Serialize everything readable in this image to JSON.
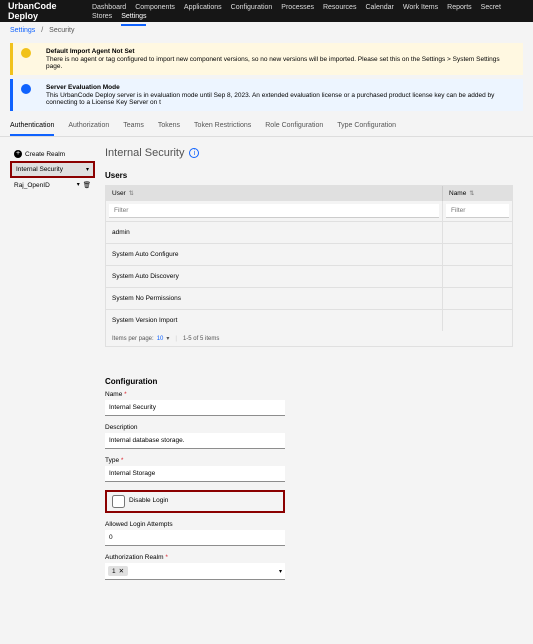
{
  "brand": "UrbanCode Deploy",
  "nav": [
    "Dashboard",
    "Components",
    "Applications",
    "Configuration",
    "Processes",
    "Resources",
    "Calendar",
    "Work Items",
    "Reports",
    "Secret Stores",
    "Settings"
  ],
  "nav_active": 10,
  "breadcrumb": {
    "root": "Settings",
    "sep": "/",
    "current": "Security"
  },
  "alerts": [
    {
      "type": "warn",
      "title": "Default Import Agent Not Set",
      "body": "There is no agent or tag configured to import new component versions, so no new versions will be imported. Please set this on the Settings > System Settings page."
    },
    {
      "type": "info",
      "title": "Server Evaluation Mode",
      "body": "This UrbanCode Deploy server is in evaluation mode until Sep 8, 2023. An extended evaluation license or a purchased product license key can be added by connecting to a License Key Server on t"
    }
  ],
  "subtabs": [
    "Authentication",
    "Authorization",
    "Teams",
    "Tokens",
    "Token Restrictions",
    "Role Configuration",
    "Type Configuration"
  ],
  "subtabs_active": 0,
  "sidebar": {
    "create": "Create Realm",
    "items": [
      {
        "label": "Internal Security",
        "selected": true
      },
      {
        "label": "Raj_OpenID",
        "selected": false
      }
    ]
  },
  "page_title": "Internal Security",
  "users": {
    "heading": "Users",
    "cols": {
      "user": "User",
      "name": "Name"
    },
    "filter_placeholder": "Filter",
    "rows": [
      "admin",
      "System Auto Configure",
      "System Auto Discovery",
      "System No Permissions",
      "System Version Import"
    ],
    "pager": {
      "label": "Items per page:",
      "pp": "10",
      "range": "1-5 of 5 items"
    }
  },
  "config": {
    "heading": "Configuration",
    "name_label": "Name",
    "name_value": "Internal Security",
    "desc_label": "Description",
    "desc_value": "Internal database storage.",
    "type_label": "Type",
    "type_value": "Internal Storage",
    "disable_login": "Disable Login",
    "attempts_label": "Allowed Login Attempts",
    "attempts_value": "0",
    "authz_label": "Authorization Realm",
    "authz_chip": "1"
  }
}
